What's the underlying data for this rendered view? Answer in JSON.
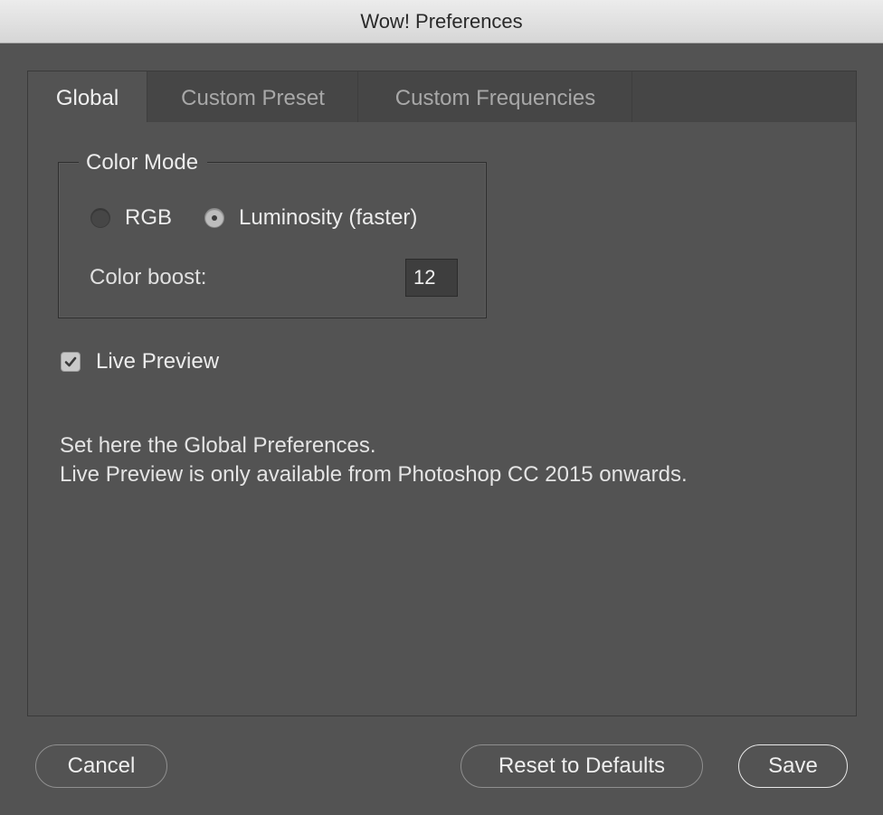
{
  "window": {
    "title": "Wow! Preferences"
  },
  "tabs": [
    {
      "label": "Global",
      "active": true
    },
    {
      "label": "Custom Preset",
      "active": false
    },
    {
      "label": "Custom Frequencies",
      "active": false
    }
  ],
  "color_mode": {
    "legend": "Color Mode",
    "options": [
      {
        "label": "RGB",
        "selected": false
      },
      {
        "label": "Luminosity (faster)",
        "selected": true
      }
    ],
    "boost_label": "Color boost:",
    "boost_value": "12"
  },
  "live_preview": {
    "label": "Live Preview",
    "checked": true
  },
  "info": {
    "line1": "Set here the Global Preferences.",
    "line2": "Live Preview is only available from Photoshop CC 2015 onwards."
  },
  "buttons": {
    "cancel": "Cancel",
    "reset": "Reset to Defaults",
    "save": "Save"
  },
  "icons": {
    "checkbox": "checkmark-icon",
    "radio_selected": "radio-dot-icon"
  }
}
